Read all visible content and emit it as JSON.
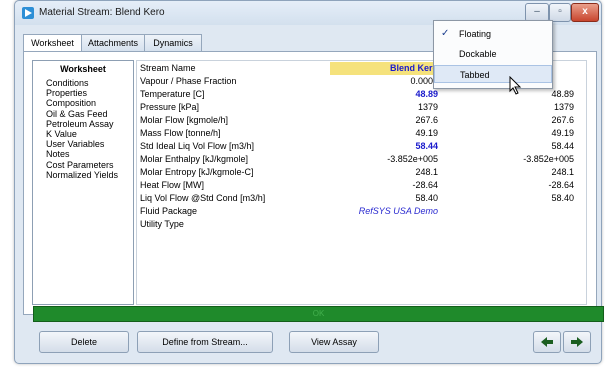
{
  "window": {
    "title": "Material Stream: Blend Kero",
    "icon": "stream-arrow-icon",
    "controls": {
      "minimize": "–",
      "maximize": "▫",
      "close": "x"
    }
  },
  "tabs": [
    {
      "label": "Worksheet",
      "active": true
    },
    {
      "label": "Attachments",
      "active": false
    },
    {
      "label": "Dynamics",
      "active": false
    }
  ],
  "nav": {
    "title": "Worksheet",
    "items": [
      "Conditions",
      "Properties",
      "Composition",
      "Oil & Gas Feed",
      "Petroleum Assay",
      "K Value",
      "User Variables",
      "Notes",
      "Cost Parameters",
      "Normalized Yields"
    ]
  },
  "grid": {
    "rows": [
      {
        "name": "Stream Name",
        "v1": "Blend Kero",
        "v2": ""
      },
      {
        "name": "Vapour / Phase Fraction",
        "v1": "0.0000",
        "v2": ""
      },
      {
        "name": "Temperature [C]",
        "v1": "48.89",
        "v2": "48.89"
      },
      {
        "name": "Pressure [kPa]",
        "v1": "1379",
        "v2": "1379"
      },
      {
        "name": "Molar Flow [kgmole/h]",
        "v1": "267.6",
        "v2": "267.6"
      },
      {
        "name": "Mass Flow [tonne/h]",
        "v1": "49.19",
        "v2": "49.19"
      },
      {
        "name": "Std Ideal Liq Vol Flow [m3/h]",
        "v1": "58.44",
        "v2": "58.44"
      },
      {
        "name": "Molar Enthalpy [kJ/kgmole]",
        "v1": "-3.852e+005",
        "v2": "-3.852e+005"
      },
      {
        "name": "Molar Entropy [kJ/kgmole-C]",
        "v1": "248.1",
        "v2": "248.1"
      },
      {
        "name": "Heat Flow [MW]",
        "v1": "-28.64",
        "v2": "-28.64"
      },
      {
        "name": "Liq Vol Flow @Std Cond [m3/h]",
        "v1": "58.40",
        "v2": "58.40"
      },
      {
        "name": "Fluid Package",
        "v1": "RefSYS USA Demo",
        "v2": ""
      },
      {
        "name": "Utility Type",
        "v1": "",
        "v2": ""
      }
    ]
  },
  "status": {
    "text": "OK",
    "color": "#1f8a2b"
  },
  "buttons": {
    "delete": "Delete",
    "define_from_stream": "Define from Stream...",
    "view_assay": "View Assay",
    "prev_icon": "left-arrow-icon",
    "next_icon": "right-arrow-icon"
  },
  "menu": {
    "items": [
      {
        "label": "Floating",
        "checked": true
      },
      {
        "label": "Dockable",
        "checked": false
      },
      {
        "label": "Tabbed",
        "checked": false,
        "hover": true
      }
    ]
  },
  "colors": {
    "highlight": "#f5e27c",
    "accent_blue": "#1a1acc",
    "status_green": "#1f8a2b"
  }
}
